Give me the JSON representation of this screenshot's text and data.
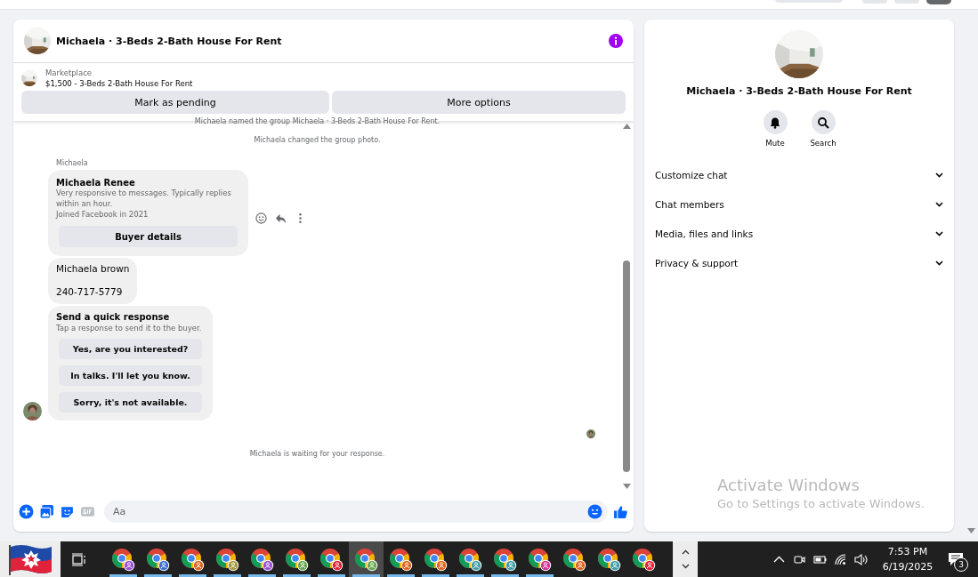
{
  "conversation": {
    "title": "Michaela · 3-Beds 2-Bath House For Rent",
    "listing": {
      "source": "Marketplace",
      "title": "$1,500 - 3-Beds 2-Bath House For Rent"
    },
    "actions": [
      "Mark as pending",
      "More options"
    ],
    "messages": [
      {
        "kind": "system",
        "text": "Michaela named the group Michaela · 3-Beds 2-Bath House For Rent."
      },
      {
        "kind": "system",
        "text": "Michaela changed the group photo."
      },
      {
        "kind": "sender",
        "text": "Michaela"
      },
      {
        "kind": "profile_card",
        "name": "Michaela Renee",
        "details": [
          "Very responsive to messages. Typically replies within an hour.",
          "Joined Facebook in 2021"
        ],
        "button": "Buyer details"
      },
      {
        "kind": "text",
        "lines": [
          "Michaela brown",
          "240-717-5779"
        ]
      },
      {
        "kind": "quick_responses",
        "title": "Send a quick response",
        "subtitle": "Tap a response to send it to the buyer.",
        "options": [
          "Yes, are you interested?",
          "In talks. I'll let you know.",
          "Sorry, it's not available."
        ]
      },
      {
        "kind": "read_receipt"
      },
      {
        "kind": "system",
        "text": "Michaela is waiting for your response."
      }
    ],
    "composer": {
      "placeholder": "Aa"
    }
  },
  "details": {
    "title": "Michaela · 3-Beds 2-Bath House For Rent",
    "actions": [
      {
        "kind": "mute",
        "label": "Mute"
      },
      {
        "kind": "search",
        "label": "Search"
      }
    ],
    "sections": [
      {
        "label": "Customize chat",
        "expanded": false
      },
      {
        "label": "Chat members",
        "expanded": false
      },
      {
        "label": "Media, files and links",
        "expanded": false
      },
      {
        "label": "Privacy & support",
        "expanded": false
      }
    ]
  },
  "activation_notice": {
    "title": "Activate Windows",
    "text": "Go to Settings to activate Windows."
  },
  "taskbar": {
    "apps": [
      {
        "color": "#9b4fd6",
        "running": true,
        "selected": false
      },
      {
        "color": "#3d6fd8",
        "running": true,
        "selected": false
      },
      {
        "color": "#e0641e",
        "running": true,
        "selected": false
      },
      {
        "color": "#a59a3c",
        "running": true,
        "selected": false
      },
      {
        "color": "#9b4fd6",
        "running": true,
        "selected": false
      },
      {
        "color": "#6aa84f",
        "running": true,
        "selected": false
      },
      {
        "color": "#e0223a",
        "running": true,
        "selected": false
      },
      {
        "color": "#6aa84f",
        "running": true,
        "selected": true
      },
      {
        "color": "#e0641e",
        "running": true,
        "selected": false
      },
      {
        "color": "#e0641e",
        "running": true,
        "selected": false
      },
      {
        "color": "#3fa0a8",
        "running": true,
        "selected": false
      },
      {
        "color": "#3fa0a8",
        "running": true,
        "selected": false
      },
      {
        "color": "#d6339a",
        "running": true,
        "selected": false
      },
      {
        "color": "#e0641e",
        "running": false,
        "selected": false
      },
      {
        "color": "#3fa0a8",
        "running": false,
        "selected": false
      },
      {
        "color": "#e0223a",
        "running": false,
        "selected": false
      }
    ],
    "clock": {
      "time": "7:53 PM",
      "date": "6/19/2025"
    },
    "notifications": "3"
  }
}
